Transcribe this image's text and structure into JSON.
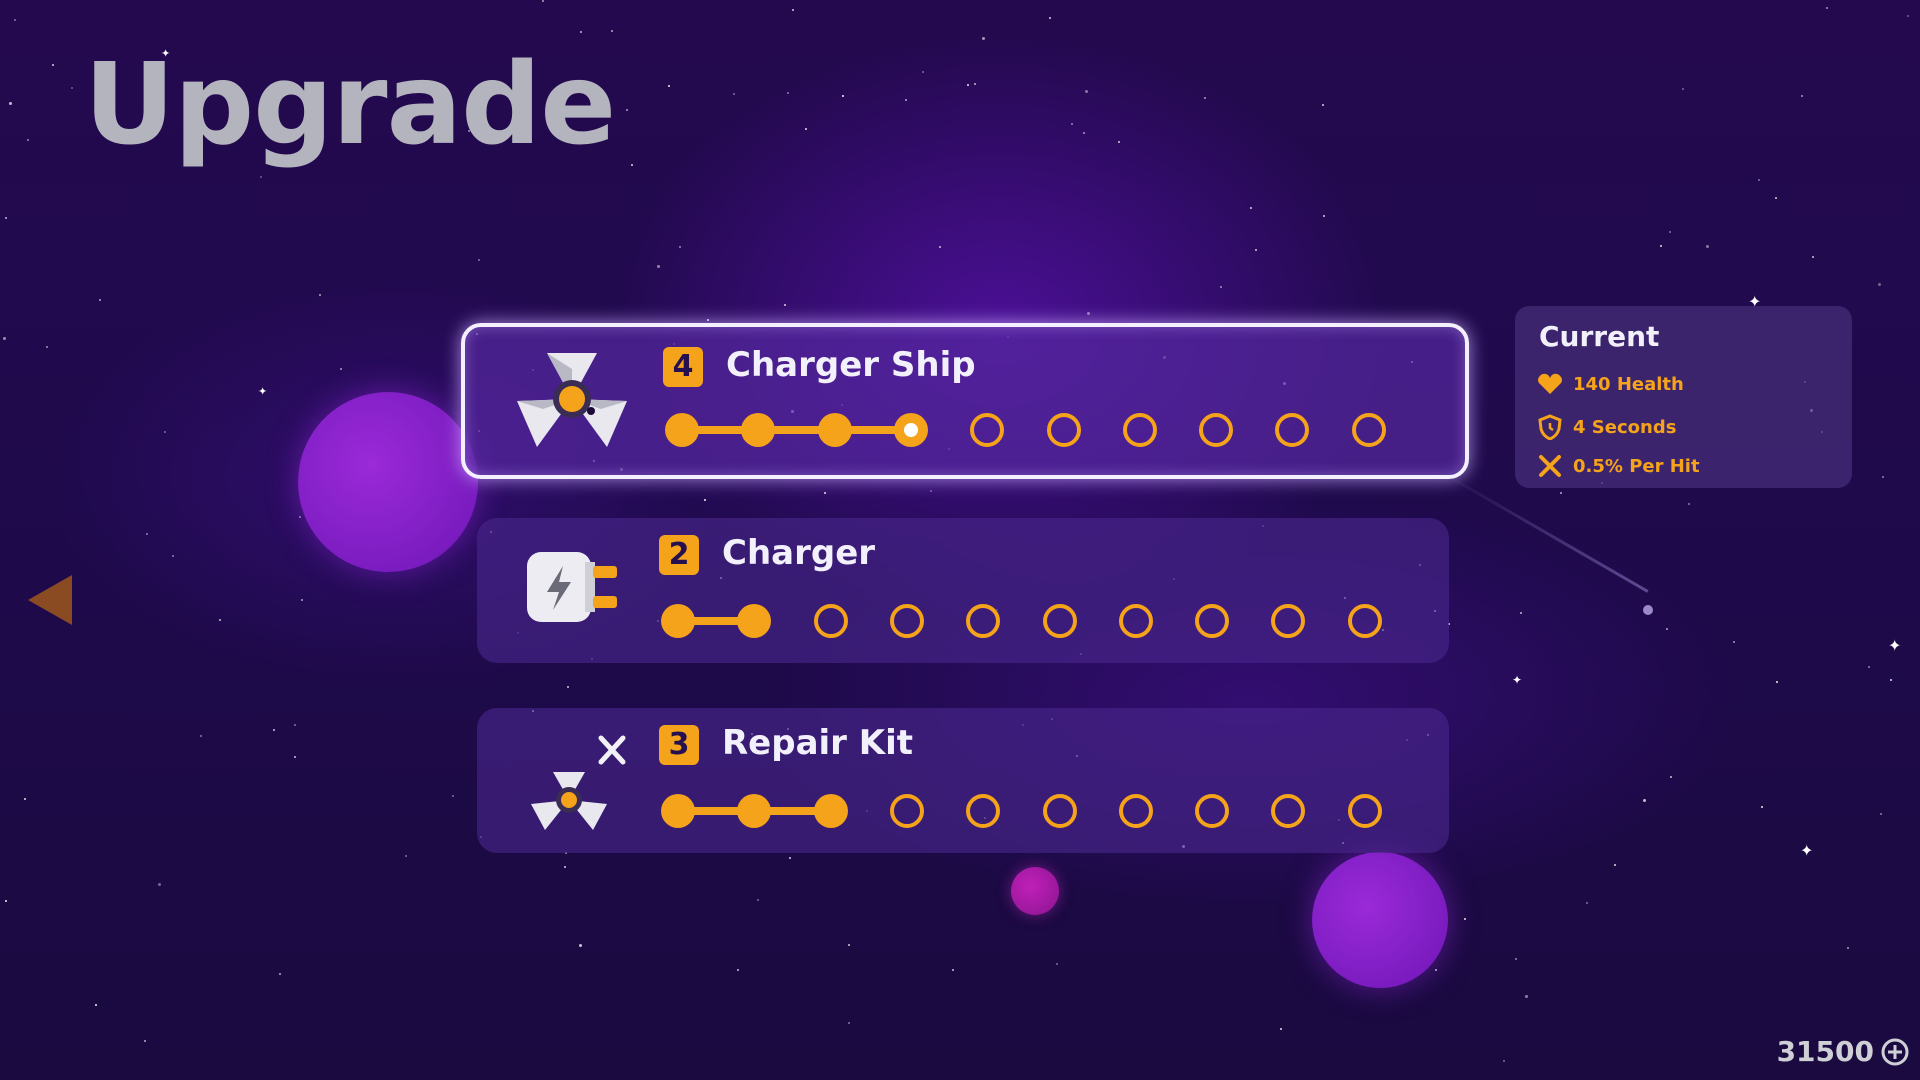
{
  "screen": {
    "title": "Upgrade"
  },
  "upgrades": [
    {
      "id": "charger-ship",
      "name": "Charger Ship",
      "level": "4",
      "level_value": 4,
      "max_level": 10,
      "selected": true,
      "icon": "charger-ship-icon"
    },
    {
      "id": "charger",
      "name": "Charger",
      "level": "2",
      "level_value": 2,
      "max_level": 10,
      "selected": false,
      "icon": "charger-plug-icon"
    },
    {
      "id": "repair-kit",
      "name": "Repair Kit",
      "level": "3",
      "level_value": 3,
      "max_level": 10,
      "selected": false,
      "icon": "repair-ship-icon"
    }
  ],
  "current_panel": {
    "title": "Current",
    "stats": [
      {
        "icon": "heart-icon",
        "text": "140 Health"
      },
      {
        "icon": "timer-shield-icon",
        "text": "4 Seconds"
      },
      {
        "icon": "wrench-cross-icon",
        "text": "0.5% Per Hit"
      }
    ]
  },
  "navigation": {
    "back_icon": "back-arrow-icon"
  },
  "currency": {
    "amount": "31500",
    "icon": "coin-plus-icon"
  },
  "colors": {
    "accent": "#f5a31a",
    "text": "#f2f0fb",
    "title": "#b4b4bf",
    "background": "#1f0a4c"
  }
}
